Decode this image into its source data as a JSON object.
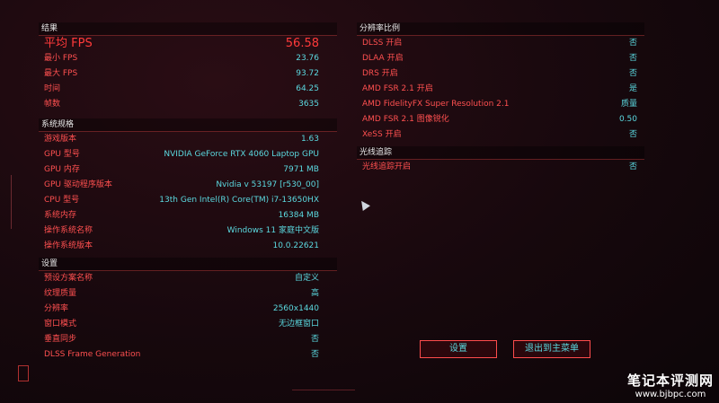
{
  "results": {
    "header": "结果",
    "avg": {
      "label": "平均 FPS",
      "value": "56.58"
    },
    "rows": [
      {
        "label": "最小 FPS",
        "value": "23.76"
      },
      {
        "label": "最大 FPS",
        "value": "93.72"
      },
      {
        "label": "时间",
        "value": "64.25"
      },
      {
        "label": "帧数",
        "value": "3635"
      }
    ]
  },
  "system": {
    "header": "系统规格",
    "rows": [
      {
        "label": "游戏版本",
        "value": "1.63"
      },
      {
        "label": "GPU 型号",
        "value": "NVIDIA GeForce RTX 4060 Laptop GPU"
      },
      {
        "label": "GPU 内存",
        "value": "7971 MB"
      },
      {
        "label": "GPU 驱动程序版本",
        "value": "Nvidia v 53197 [r530_00]"
      },
      {
        "label": "CPU 型号",
        "value": "13th Gen Intel(R) Core(TM) i7-13650HX"
      },
      {
        "label": "系统内存",
        "value": "16384 MB"
      },
      {
        "label": "操作系统名称",
        "value": "Windows 11 家庭中文版"
      },
      {
        "label": "操作系统版本",
        "value": "10.0.22621"
      }
    ]
  },
  "settings": {
    "header": "设置",
    "rows": [
      {
        "label": "预设方案名称",
        "value": "自定义"
      },
      {
        "label": "纹理质量",
        "value": "高"
      },
      {
        "label": "分辨率",
        "value": "2560x1440"
      },
      {
        "label": "窗口模式",
        "value": "无边框窗口"
      },
      {
        "label": "垂直同步",
        "value": "否"
      },
      {
        "label": "DLSS Frame Generation",
        "value": "否"
      }
    ]
  },
  "resolution_scaling": {
    "header": "分辨率比例",
    "rows": [
      {
        "label": "DLSS 开启",
        "value": "否"
      },
      {
        "label": "DLAA 开启",
        "value": "否"
      },
      {
        "label": "DRS 开启",
        "value": "否"
      },
      {
        "label": "AMD FSR 2.1 开启",
        "value": "是"
      },
      {
        "label": "AMD FidelityFX Super Resolution 2.1",
        "value": "质量"
      },
      {
        "label": "AMD FSR 2.1 图像锐化",
        "value": "0.50"
      },
      {
        "label": "XeSS 开启",
        "value": "否"
      }
    ]
  },
  "ray_tracing": {
    "header": "光线追踪",
    "rows": [
      {
        "label": "光线追踪开启",
        "value": "否"
      }
    ]
  },
  "buttons": {
    "settings": "设置",
    "exit": "退出到主菜单"
  },
  "watermark": {
    "line1": "笔记本评测网",
    "line2": "www.bjbpc.com"
  },
  "colors": {
    "label": "#ff5050",
    "value": "#5bd9e0",
    "accent": "#ff3a3a"
  }
}
